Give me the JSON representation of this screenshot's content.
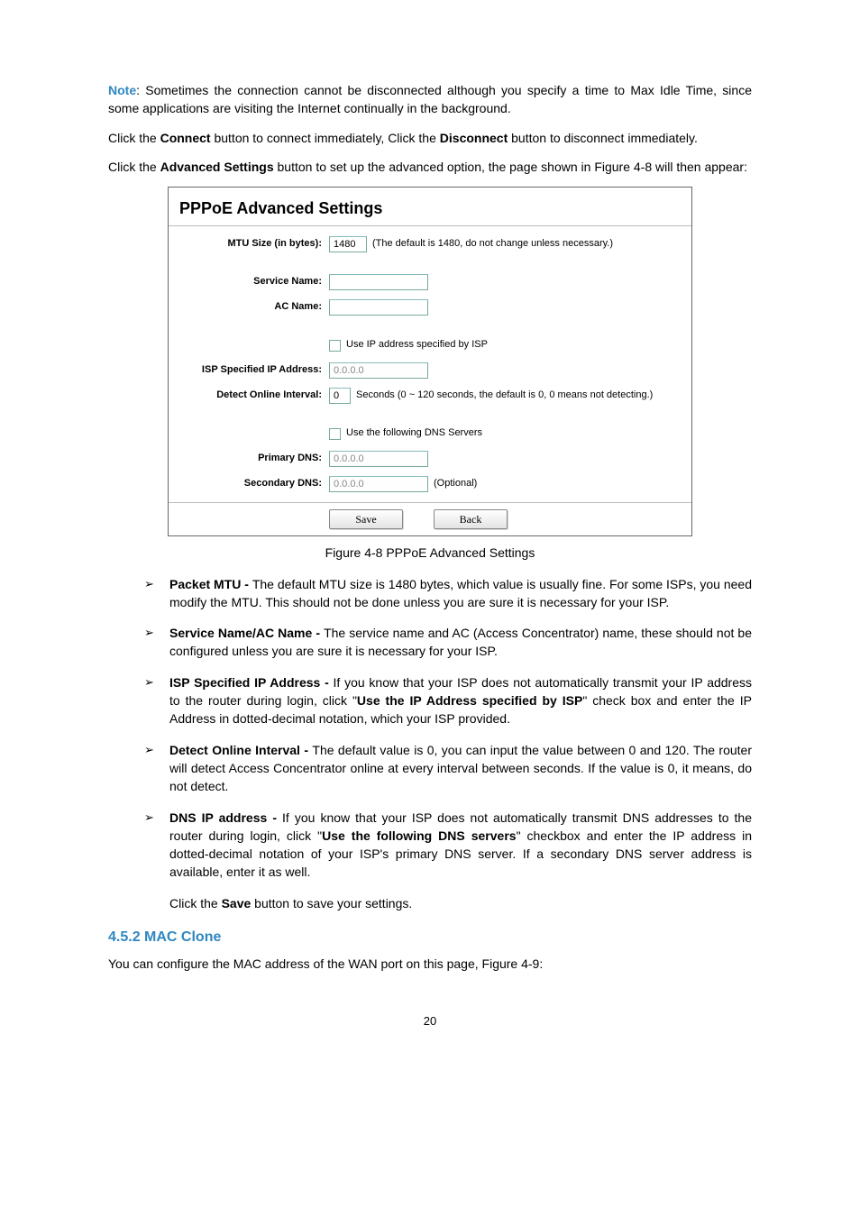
{
  "intro": {
    "note_label": "Note",
    "note_text": ": Sometimes the connection cannot be disconnected although you specify a time to Max Idle Time, since some applications are visiting the Internet continually in the background.",
    "click_connect_1": "Click the ",
    "btn_connect": "Connect",
    "click_connect_2": " button to connect immediately, Click the ",
    "btn_disconnect": "Disconnect",
    "click_connect_3": " button to disconnect immediately.",
    "click_adv_1": "Click the ",
    "btn_advanced": "Advanced Settings",
    "click_adv_2": " button to set up the advanced option, the page shown in Figure 4-8 will then appear:"
  },
  "figure": {
    "title": "PPPoE Advanced Settings",
    "rows": {
      "mtu_label": "MTU Size (in bytes):",
      "mtu_value": "1480",
      "mtu_hint": "(The default is 1480, do not change unless necessary.)",
      "service_label": "Service Name:",
      "ac_label": "AC Name:",
      "use_ip_label": "Use IP address specified by ISP",
      "isp_ip_label": "ISP Specified IP Address:",
      "isp_ip_value": "0.0.0.0",
      "detect_label": "Detect Online Interval:",
      "detect_value": "0",
      "detect_hint": "Seconds (0 ~ 120 seconds, the default is 0, 0 means not detecting.)",
      "use_dns_label": "Use the following DNS Servers",
      "primary_dns_label": "Primary DNS:",
      "primary_dns_value": "0.0.0.0",
      "secondary_dns_label": "Secondary DNS:",
      "secondary_dns_value": "0.0.0.0",
      "optional": "(Optional)"
    },
    "buttons": {
      "save": "Save",
      "back": "Back"
    },
    "caption": "Figure 4-8 PPPoE Advanced Settings"
  },
  "bullets": [
    {
      "lead": "Packet MTU - ",
      "text": "The default MTU size is 1480 bytes, which value is usually fine. For some ISPs, you need modify the MTU. This should not be done unless you are sure it is necessary for your ISP."
    },
    {
      "lead": "Service Name/AC Name - ",
      "text": "The service name and AC (Access Concentrator) name, these should not be configured unless you are sure it is necessary for your ISP."
    },
    {
      "lead": "ISP Specified IP Address - ",
      "text_a": "If you know that your ISP does not automatically transmit your IP address to the router during login, click \"",
      "inner_bold": "Use the IP Address specified by ISP",
      "text_b": "\" check box and enter the IP Address in dotted-decimal notation, which your ISP provided."
    },
    {
      "lead": "Detect Online Interval - ",
      "text": "The default value is 0, you can input the value between 0 and 120. The router will detect Access Concentrator online at every interval between seconds. If the value is 0, it means, do not detect."
    },
    {
      "lead": "DNS IP address - ",
      "text_a": "If you know that your ISP does not automatically transmit DNS addresses to the router during login, click \"",
      "inner_bold": "Use the following DNS servers",
      "text_b": "\" checkbox and enter the IP address in dotted-decimal notation of your ISP's primary DNS server. If a secondary DNS server address is available, enter it as well."
    }
  ],
  "save_line": {
    "a": "Click the ",
    "btn": "Save",
    "b": " button to save your settings."
  },
  "section": {
    "num": "4.5.2  MAC Clone",
    "text": "You can configure the MAC address of the WAN port on this page, Figure 4-9:"
  },
  "page_number": "20"
}
